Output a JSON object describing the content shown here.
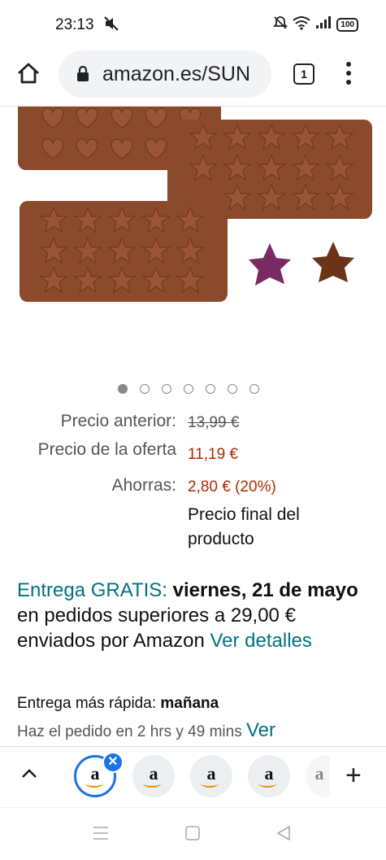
{
  "status_bar": {
    "time": "23:13",
    "battery": "100"
  },
  "browser": {
    "url": "amazon.es/SUN",
    "tab_count": "1"
  },
  "gallery": {
    "image_count": 7,
    "active_index": 0
  },
  "price": {
    "previous_label": "Precio anterior:",
    "previous_value": "13,99 €",
    "offer_label": "Precio de la oferta",
    "offer_value": "11,19 €",
    "savings_label": "Ahorras:",
    "savings_value": "2,80 € (20%)",
    "final_note_line1": "Precio final del",
    "final_note_line2": "producto"
  },
  "delivery": {
    "free_label": "Entrega GRATIS:",
    "date": "viernes, 21 de mayo",
    "rest": "en pedidos superiores a 29,00 € enviados por Amazon",
    "details_link": "Ver detalles",
    "fast_label": "Entrega más rápida:",
    "fast_value": "mañana",
    "order_text": "Haz el pedido en 2 hrs y 49 mins",
    "order_link": "Ver"
  },
  "tab_strip": {
    "tabs": [
      "a",
      "a",
      "a",
      "a",
      "a"
    ]
  },
  "colors": {
    "accent": "#1a73e8",
    "price_red": "#b12704",
    "link_teal": "#007185",
    "chocolate": "#8b4a2b"
  }
}
